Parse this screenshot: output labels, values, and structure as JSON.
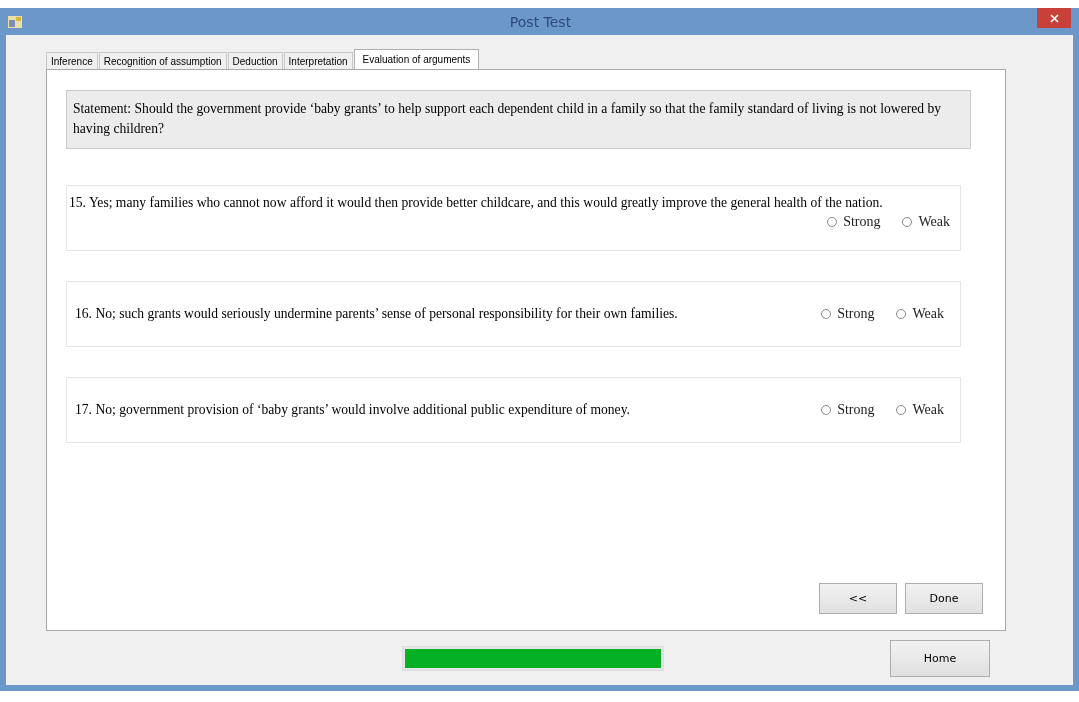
{
  "window": {
    "title": "Post Test"
  },
  "tabs": [
    {
      "label": "Inference",
      "selected": false
    },
    {
      "label": "Recognition of assumption",
      "selected": false
    },
    {
      "label": "Deduction",
      "selected": false
    },
    {
      "label": "Interpretation",
      "selected": false
    },
    {
      "label": "Evaluation of arguments",
      "selected": true
    }
  ],
  "statement": "Statement: Should the government provide ‘baby grants’ to help support each dependent child in a family so that the family standard of living is not lowered by having children?",
  "questions": [
    {
      "text": "15. Yes; many families who cannot now afford it would then provide better childcare, and this would greatly improve the general health of the nation.",
      "options": [
        {
          "label": "Strong",
          "selected": false
        },
        {
          "label": "Weak",
          "selected": false
        }
      ]
    },
    {
      "text": "16. No; such grants would seriously undermine parents’ sense of personal responsibility for their own families.",
      "options": [
        {
          "label": "Strong",
          "selected": false
        },
        {
          "label": "Weak",
          "selected": false
        }
      ]
    },
    {
      "text": "17. No; government provision of ‘baby grants’ would involve additional public expenditure of money.",
      "options": [
        {
          "label": "Strong",
          "selected": false
        },
        {
          "label": "Weak",
          "selected": false
        }
      ]
    }
  ],
  "nav_buttons": [
    "<<",
    "Done"
  ],
  "progress": {
    "level": 1
  },
  "home_button": "Home"
}
